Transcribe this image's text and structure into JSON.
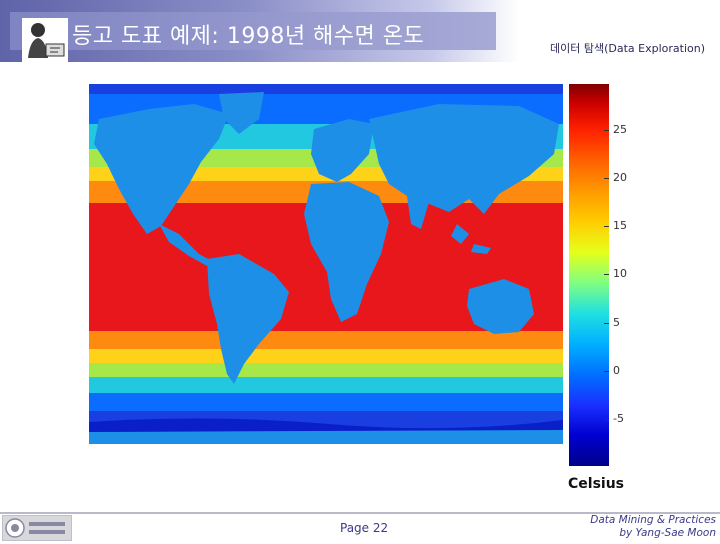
{
  "header": {
    "title": "등고 도표 예제: 1998년 해수면 온도",
    "subtitle": "데이터 탐색(Data Exploration)"
  },
  "colorbar": {
    "ticks": [
      "25",
      "20",
      "15",
      "10",
      "5",
      "0",
      "-5"
    ],
    "unit": "Celsius",
    "range": [
      -8,
      31
    ]
  },
  "footer": {
    "page": "Page 22",
    "credit_line1": "Data Mining & Practices",
    "credit_line2": "by Yang-Sae Moon"
  },
  "colors": {
    "ocean_warm": "#e8171b",
    "ocean_cold": "#1a3fe0",
    "land": "#1e8fe6"
  }
}
